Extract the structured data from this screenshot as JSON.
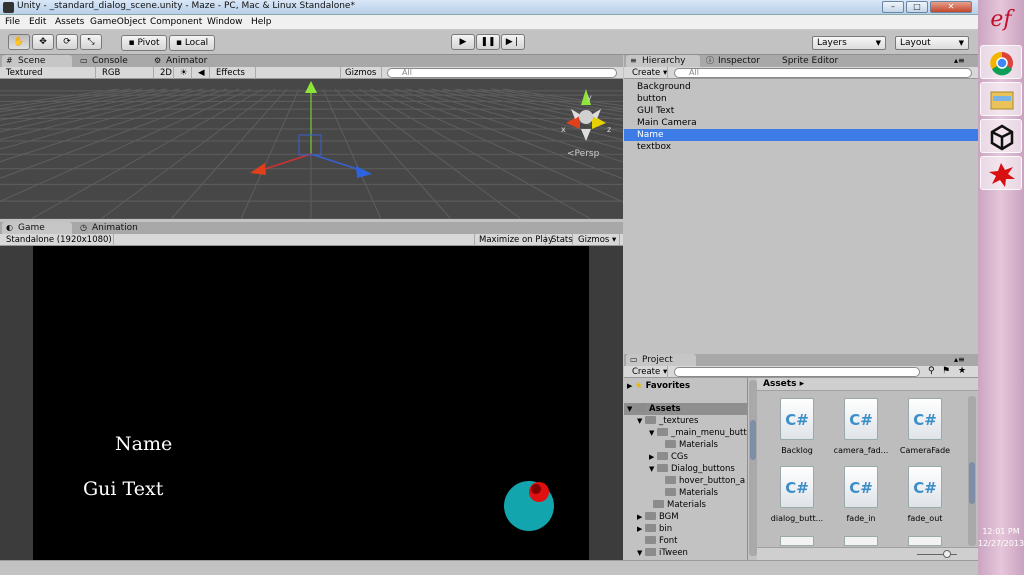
{
  "window": {
    "title": "Unity - _standard_dialog_scene.unity - Maze - PC, Mac & Linux Standalone*",
    "minimize": "–",
    "maximize": "□",
    "close": "✕"
  },
  "menu": [
    "File",
    "Edit",
    "Assets",
    "GameObject",
    "Component",
    "Window",
    "Help"
  ],
  "toolbar": {
    "pivot": "Pivot",
    "local": "Local",
    "layers": "Layers",
    "layout": "Layout"
  },
  "scene": {
    "tabs": [
      "Scene",
      "Console",
      "Animator"
    ],
    "shading": "Textured",
    "render": "RGB",
    "mode2d": "2D",
    "effects": "Effects",
    "gizmos": "Gizmos",
    "search_placeholder": "All",
    "persp": "Persp",
    "axis_x": "x",
    "axis_y": "y",
    "axis_z": "z"
  },
  "game": {
    "tabs": [
      "Game",
      "Animation"
    ],
    "resolution": "Standalone (1920x1080)",
    "maximize_on_play": "Maximize on Play",
    "stats": "Stats",
    "gizmos": "Gizmos",
    "text_name": "Name",
    "text_gui": "Gui Text"
  },
  "hierarchy": {
    "tabs": [
      "Hierarchy",
      "Inspector",
      "Sprite Editor"
    ],
    "create": "Create",
    "search_placeholder": "All",
    "items": [
      "Background",
      "button",
      "GUI Text",
      "Main Camera",
      "Name",
      "textbox"
    ],
    "selected_index": 4
  },
  "project": {
    "tab": "Project",
    "create": "Create",
    "favorites": "Favorites",
    "tree": [
      "Assets",
      "_textures",
      "_main_menu_butt",
      "Materials",
      "CGs",
      "Dialog_buttons",
      "hover_button_a",
      "Materials",
      "Materials",
      "BGM",
      "bin",
      "Font",
      "iTween"
    ],
    "breadcrumb": "Assets",
    "assets": [
      "Backlog",
      "camera_fad...",
      "CameraFade",
      "dialog_butt...",
      "fade_in",
      "fade_out"
    ],
    "cs_glyph": "C#"
  },
  "taskbar": {
    "time": "12:01 PM",
    "date": "12/27/2013"
  },
  "colors": {
    "selection": "#3d7be6",
    "editor_bg": "#c2c2c2",
    "scene_bg": "#474747",
    "game_bg": "#000000",
    "circle": "#12a5ad",
    "dot": "#e01010"
  }
}
